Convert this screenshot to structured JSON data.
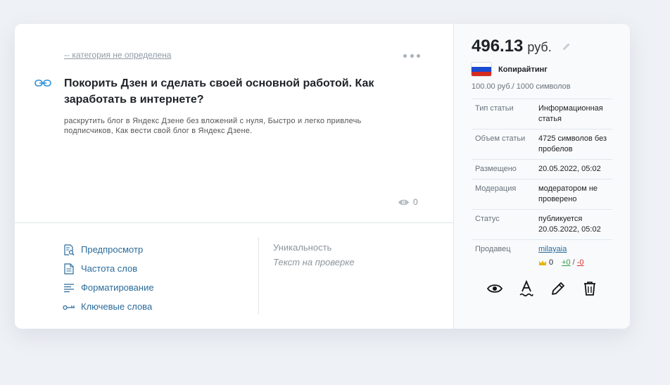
{
  "article": {
    "category": "-- категория не определена",
    "title": "Покорить Дзен и сделать своей основной работой. Как заработать в интернете?",
    "keywords": "раскрутить блог в Яндекс Дзене без вложений с нуля, Быстро и легко привлечь подписчиков, Как вести свой блог в Яндекс Дзене.",
    "views": "0"
  },
  "tools": {
    "preview": "Предпросмотр",
    "word_freq": "Частота слов",
    "formatting": "Форматирование",
    "keywords": "Ключевые слова"
  },
  "uniqueness": {
    "label": "Уникальность",
    "value": "Текст на проверке"
  },
  "sidebar": {
    "price": "496.13",
    "currency": "руб.",
    "category": "Копирайтинг",
    "rate": "100.00 руб./ 1000 символов",
    "info": [
      {
        "key": "Тип статьи",
        "value": "Информационная статья"
      },
      {
        "key": "Объем статьи",
        "value": "4725 символов без пробелов"
      },
      {
        "key": "Размещено",
        "value": "20.05.2022, 05:02"
      },
      {
        "key": "Модерация",
        "value": "модератором не проверено"
      },
      {
        "key": "Статус",
        "value": "публикуется 20.05.2022, 05:02"
      }
    ],
    "seller": {
      "label": "Продавец",
      "name": "milayaia",
      "crowns": "0",
      "plus": "+0",
      "separator": "/",
      "minus": "-0"
    }
  },
  "colors": {
    "link": "#2a6b9a",
    "positive": "#2f9e44",
    "negative": "#d9302c"
  }
}
